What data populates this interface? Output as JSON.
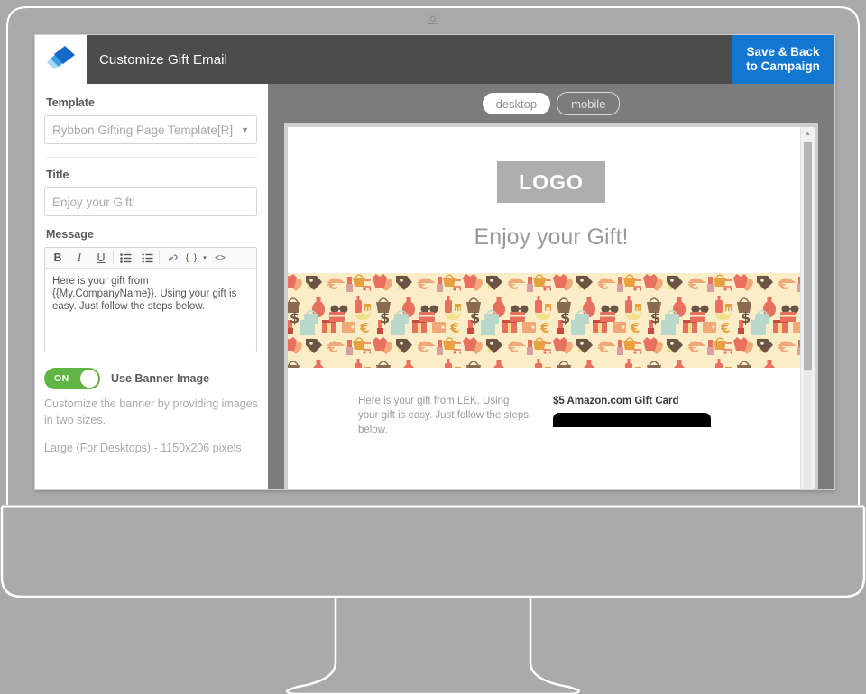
{
  "device": {
    "webcam_icon": "webcam-icon"
  },
  "header": {
    "logo_icon": "rybbon-logo-icon",
    "title": "Customize Gift Email",
    "save_button_line1": "Save & Back",
    "save_button_line2": "to Campaign",
    "accent_color": "#1177d1",
    "bar_color": "#4c4c4c"
  },
  "sidebar": {
    "template": {
      "label": "Template",
      "value": "Rybbon Gifting Page Template[R]",
      "caret_icon": "chevron-down-icon"
    },
    "title": {
      "label": "Title",
      "placeholder": "Enjoy your Gift!"
    },
    "message": {
      "label": "Message",
      "value": "Here is your gift from {{My.CompanyName}}. Using your gift is easy. Just follow the steps below.",
      "toolbar": [
        {
          "name": "bold-icon",
          "glyph": "B"
        },
        {
          "name": "italic-icon",
          "glyph": "I"
        },
        {
          "name": "underline-icon",
          "glyph": "U"
        },
        {
          "name": "bullet-list-icon",
          "glyph": "☰"
        },
        {
          "name": "numbered-list-icon",
          "glyph": "≡"
        },
        {
          "name": "link-icon",
          "glyph": "🔗"
        },
        {
          "name": "merge-field-icon",
          "glyph": "{..}"
        },
        {
          "name": "merge-field-caret-icon",
          "glyph": "▾"
        },
        {
          "name": "code-icon",
          "glyph": "<>"
        }
      ]
    },
    "banner_toggle": {
      "state": "ON",
      "label": "Use Banner Image",
      "on_color": "#61b544"
    },
    "helper_text": "Customize the banner by providing images in two sizes.",
    "size_text": "Large (For Desktops) - 1150x206 pixels"
  },
  "preview": {
    "device_tabs": [
      {
        "label": "desktop",
        "active": true
      },
      {
        "label": "mobile",
        "active": false
      }
    ],
    "logo_placeholder": "LOGO",
    "title": "Enjoy your Gift!",
    "banner_icon": "shopping-pattern-banner",
    "banner_bg": "#fbedc8",
    "message": "Here is your gift from LEK. Using your gift is easy. Just follow the steps below.",
    "card_title": "$5 Amazon.com Gift Card",
    "scrollbar": {
      "up_arrow_icon": "scroll-up-arrow-icon"
    }
  }
}
